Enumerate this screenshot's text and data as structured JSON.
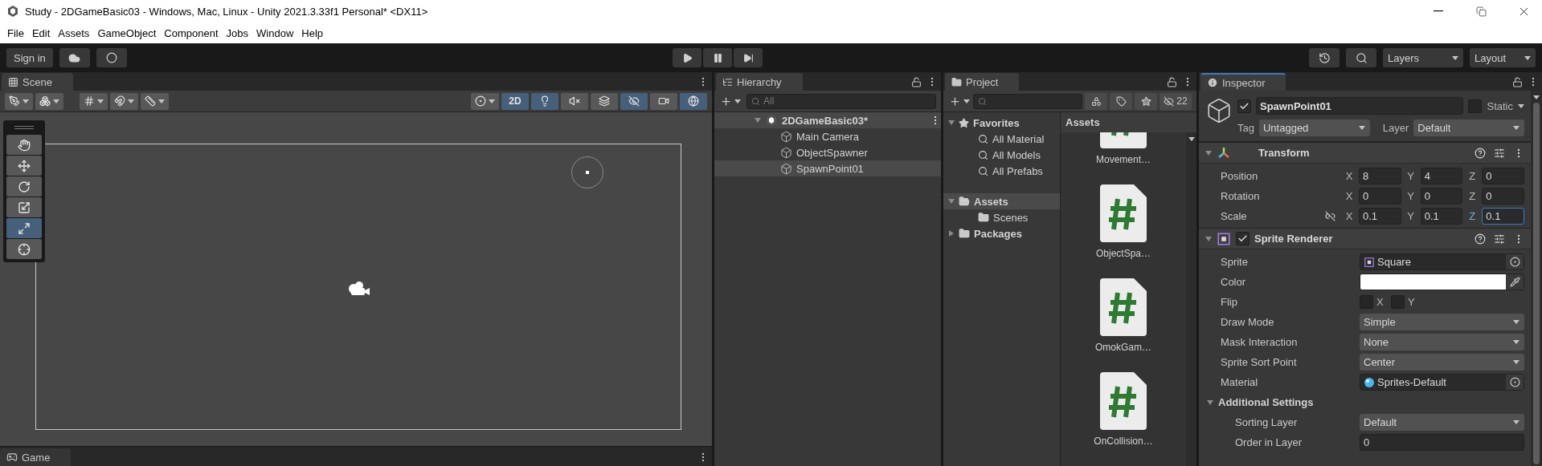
{
  "window": {
    "title": "Study - 2DGameBasic03 - Windows, Mac, Linux - Unity 2021.3.33f1 Personal* <DX11>",
    "menu": [
      "File",
      "Edit",
      "Assets",
      "GameObject",
      "Component",
      "Jobs",
      "Window",
      "Help"
    ]
  },
  "toolbar": {
    "sign_in": "Sign in",
    "layers": "Layers",
    "layout": "Layout"
  },
  "scene": {
    "tab": "Scene",
    "toggles": [
      {
        "kind": "mode",
        "label": "2D",
        "on": true
      },
      {
        "kind": "lighting",
        "on": true
      },
      {
        "kind": "audio",
        "on": false
      },
      {
        "kind": "effects",
        "on": false
      },
      {
        "kind": "visibility",
        "on": true
      },
      {
        "kind": "camera",
        "on": false
      },
      {
        "kind": "gizmos",
        "on": true
      }
    ],
    "tools": [
      {
        "kind": "hand",
        "selected": false
      },
      {
        "kind": "move",
        "selected": false
      },
      {
        "kind": "rotate",
        "selected": false
      },
      {
        "kind": "scale",
        "selected": false
      },
      {
        "kind": "rect",
        "selected": true
      },
      {
        "kind": "transform",
        "selected": false
      }
    ]
  },
  "game_tab": "Game",
  "hierarchy": {
    "title": "Hierarchy",
    "search_placeholder": "All",
    "scene": {
      "name": "2DGameBasic03*",
      "expanded": true,
      "children": [
        {
          "name": "Main Camera",
          "selected": false
        },
        {
          "name": "ObjectSpawner",
          "selected": false
        },
        {
          "name": "SpawnPoint01",
          "selected": true
        }
      ]
    }
  },
  "project": {
    "title": "Project",
    "hidden_count": "22",
    "tree": [
      {
        "kind": "favorites",
        "name": "Favorites",
        "expanded": true,
        "selected": false,
        "children": [
          {
            "kind": "search",
            "name": "All Material",
            "selected": false
          },
          {
            "kind": "search",
            "name": "All Models",
            "selected": false
          },
          {
            "kind": "search",
            "name": "All Prefabs",
            "selected": false
          }
        ]
      },
      {
        "kind": "folder",
        "name": "Assets",
        "expanded": true,
        "selected": true,
        "children": [
          {
            "kind": "folder",
            "name": "Scenes",
            "selected": false
          }
        ]
      },
      {
        "kind": "folder",
        "name": "Packages",
        "expanded": false,
        "selected": false
      }
    ],
    "grid_title": "Assets",
    "items": [
      "Movement…",
      "ObjectSpa…",
      "OmokGam…",
      "OnCollision…"
    ]
  },
  "inspector": {
    "title": "Inspector",
    "object_name": "SpawnPoint01",
    "active": true,
    "static": {
      "label": "Static",
      "checked": false
    },
    "tag": {
      "label": "Tag",
      "value": "Untagged"
    },
    "layer": {
      "label": "Layer",
      "value": "Default"
    },
    "transform": {
      "title": "Transform",
      "rows": [
        {
          "label": "Position",
          "linked": false,
          "values": [
            {
              "axis": "X",
              "value": "8",
              "focused": false
            },
            {
              "axis": "Y",
              "value": "4",
              "focused": false
            },
            {
              "axis": "Z",
              "value": "0",
              "focused": false
            }
          ]
        },
        {
          "label": "Rotation",
          "linked": false,
          "values": [
            {
              "axis": "X",
              "value": "0",
              "focused": false
            },
            {
              "axis": "Y",
              "value": "0",
              "focused": false
            },
            {
              "axis": "Z",
              "value": "0",
              "focused": false
            }
          ]
        },
        {
          "label": "Scale",
          "linked": true,
          "values": [
            {
              "axis": "X",
              "value": "0.1",
              "focused": false
            },
            {
              "axis": "Y",
              "value": "0.1",
              "focused": false
            },
            {
              "axis": "Z",
              "value": "0.1",
              "focused": true
            }
          ]
        }
      ]
    },
    "sprite_renderer": {
      "title": "Sprite Renderer",
      "enabled": true,
      "fields": [
        {
          "kind": "sprite",
          "label": "Sprite",
          "value": "Square"
        },
        {
          "kind": "color",
          "label": "Color",
          "color": "#ffffff"
        },
        {
          "kind": "flip",
          "label": "Flip",
          "options": [
            {
              "label": "X",
              "checked": false
            },
            {
              "label": "Y",
              "checked": false
            }
          ]
        },
        {
          "kind": "dropdown",
          "label": "Draw Mode",
          "value": "Simple"
        },
        {
          "kind": "dropdown",
          "label": "Mask Interaction",
          "value": "None"
        },
        {
          "kind": "dropdown",
          "label": "Sprite Sort Point",
          "value": "Center"
        },
        {
          "kind": "material",
          "label": "Material",
          "value": "Sprites-Default"
        },
        {
          "kind": "section",
          "label": "Additional Settings",
          "expanded": true
        },
        {
          "kind": "dropdown",
          "label": "Sorting Layer",
          "value": "Default",
          "indent": true
        },
        {
          "kind": "number",
          "label": "Order in Layer",
          "value": "0",
          "indent": true
        }
      ]
    }
  }
}
